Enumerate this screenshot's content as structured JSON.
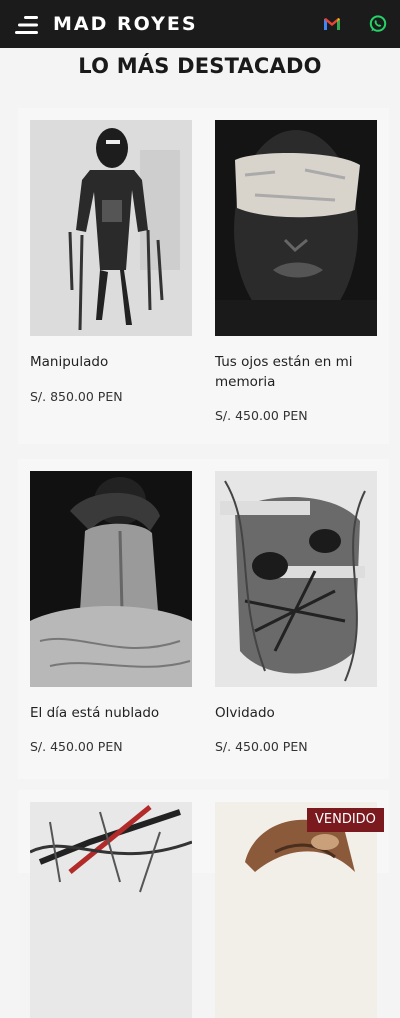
{
  "header": {
    "brand": "MAD ROYES"
  },
  "section": {
    "title": "LO MÁS DESTACADO"
  },
  "products": [
    {
      "title": "Manipulado",
      "price": "S/. 850.00 PEN"
    },
    {
      "title": "Tus ojos están en mi memoria",
      "price": "S/. 450.00 PEN"
    },
    {
      "title": "El día está nublado",
      "price": "S/. 450.00 PEN"
    },
    {
      "title": "Olvidado",
      "price": "S/. 450.00 PEN"
    }
  ],
  "sold_badge": "VENDIDO",
  "colors": {
    "topbar": "#1b1b1c",
    "sold_badge": "#7a1a1f",
    "background": "#f4f4f5"
  }
}
